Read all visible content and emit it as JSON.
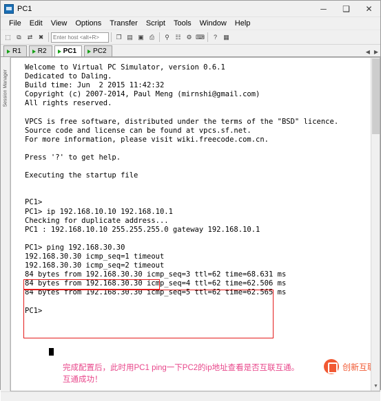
{
  "window": {
    "title": "PC1",
    "minimize_label": "─",
    "maximize_label": "❑",
    "close_label": "✕"
  },
  "menubar": {
    "items": [
      {
        "label": "File"
      },
      {
        "label": "Edit"
      },
      {
        "label": "View"
      },
      {
        "label": "Options"
      },
      {
        "label": "Transfer"
      },
      {
        "label": "Script"
      },
      {
        "label": "Tools"
      },
      {
        "label": "Window"
      },
      {
        "label": "Help"
      }
    ]
  },
  "toolbar": {
    "buttons": [
      {
        "name": "new-session-icon",
        "glyph": "⬚"
      },
      {
        "name": "clone-session-icon",
        "glyph": "⧉"
      },
      {
        "name": "connect-icon",
        "glyph": "⇄"
      },
      {
        "name": "disconnect-icon",
        "glyph": "✖"
      }
    ],
    "entry_placeholder": "Enter host <alt+R>",
    "buttons2": [
      {
        "name": "copy-icon",
        "glyph": "❐"
      },
      {
        "name": "paste-icon",
        "glyph": "▤"
      },
      {
        "name": "clipboard-icon",
        "glyph": "▣"
      },
      {
        "name": "print-icon",
        "glyph": "⎙"
      },
      {
        "name": "find-icon",
        "glyph": "⚲"
      },
      {
        "name": "log-icon",
        "glyph": "☷"
      },
      {
        "name": "settings-icon",
        "glyph": "⚙"
      },
      {
        "name": "chat-icon",
        "glyph": "⌨"
      },
      {
        "name": "help-icon",
        "glyph": "?"
      },
      {
        "name": "grid-icon",
        "glyph": "▦"
      }
    ]
  },
  "tabs": [
    {
      "label": "R1",
      "active": false
    },
    {
      "label": "R2",
      "active": false
    },
    {
      "label": "PC1",
      "active": true
    },
    {
      "label": "PC2",
      "active": false
    }
  ],
  "tabstrip": {
    "scroll_left": "◀",
    "scroll_right": "▶"
  },
  "sidebar": {
    "vertical_label": "Session Manager"
  },
  "console": {
    "text": "Welcome to Virtual PC Simulator, version 0.6.1\nDedicated to Daling.\nBuild time: Jun  2 2015 11:42:32\nCopyright (c) 2007-2014, Paul Meng (mirnshi@gmail.com)\nAll rights reserved.\n\nVPCS is free software, distributed under the terms of the \"BSD\" licence.\nSource code and license can be found at vpcs.sf.net.\nFor more information, please visit wiki.freecode.com.cn.\n\nPress '?' to get help.\n\nExecuting the startup file\n\n\nPC1>\nPC1> ip 192.168.10.10 192.168.10.1\nChecking for duplicate address...\nPC1 : 192.168.10.10 255.255.255.0 gateway 192.168.10.1\n\nPC1> ping 192.168.30.30\n192.168.30.30 icmp_seq=1 timeout\n192.168.30.30 icmp_seq=2 timeout\n84 bytes from 192.168.30.30 icmp_seq=3 ttl=62 time=68.631 ms\n84 bytes from 192.168.30.30 icmp_seq=4 ttl=62 time=62.506 ms\n84 bytes from 192.168.30.30 icmp_seq=5 ttl=62 time=62.565 ms\n\nPC1> ",
    "prompt_command": "ping 192.168.30.30"
  },
  "annotations": {
    "line1": "完成配置后，此时用PC1 ping一下PC2的ip地址查看是否互联互通。",
    "line2": "互通成功！",
    "color": "#e8468a",
    "box_color": "#e41a1a"
  },
  "scrollbar": {
    "up_arrow": "▲",
    "down_arrow": "▼"
  },
  "watermark": {
    "text": "创新互联",
    "color": "#f04c22"
  }
}
